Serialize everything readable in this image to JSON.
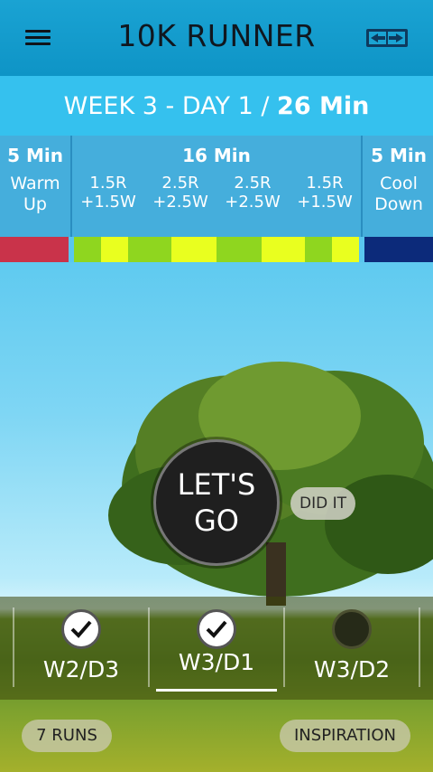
{
  "appbar": {
    "title": "10K RUNNER"
  },
  "week": {
    "prefix": "WEEK 3 - DAY 1 / ",
    "duration": "26 Min"
  },
  "schedule": {
    "warmup": {
      "duration": "5 Min",
      "label_line1": "Warm",
      "label_line2": "Up"
    },
    "main": {
      "duration": "16 Min",
      "intervals": [
        {
          "run": "1.5R",
          "walk": "+1.5W"
        },
        {
          "run": "2.5R",
          "walk": "+2.5W"
        },
        {
          "run": "2.5R",
          "walk": "+2.5W"
        },
        {
          "run": "1.5R",
          "walk": "+1.5W"
        }
      ]
    },
    "cooldown": {
      "duration": "5 Min",
      "label_line1": "Cool",
      "label_line2": "Down"
    }
  },
  "colors": {
    "warmup": "#c9334a",
    "run": "#e9ff1f",
    "walk": "#8fd61f",
    "cooldown": "#0c2a7a"
  },
  "actions": {
    "go_line1": "LET'S",
    "go_line2": "GO",
    "did_it": "DID IT"
  },
  "days": [
    {
      "label": "W2/D3",
      "status": "done"
    },
    {
      "label": "W3/D1",
      "status": "done",
      "selected": true
    },
    {
      "label": "W3/D2",
      "status": "todo"
    }
  ],
  "footer": {
    "runs": "7 RUNS",
    "inspiration": "INSPIRATION"
  }
}
